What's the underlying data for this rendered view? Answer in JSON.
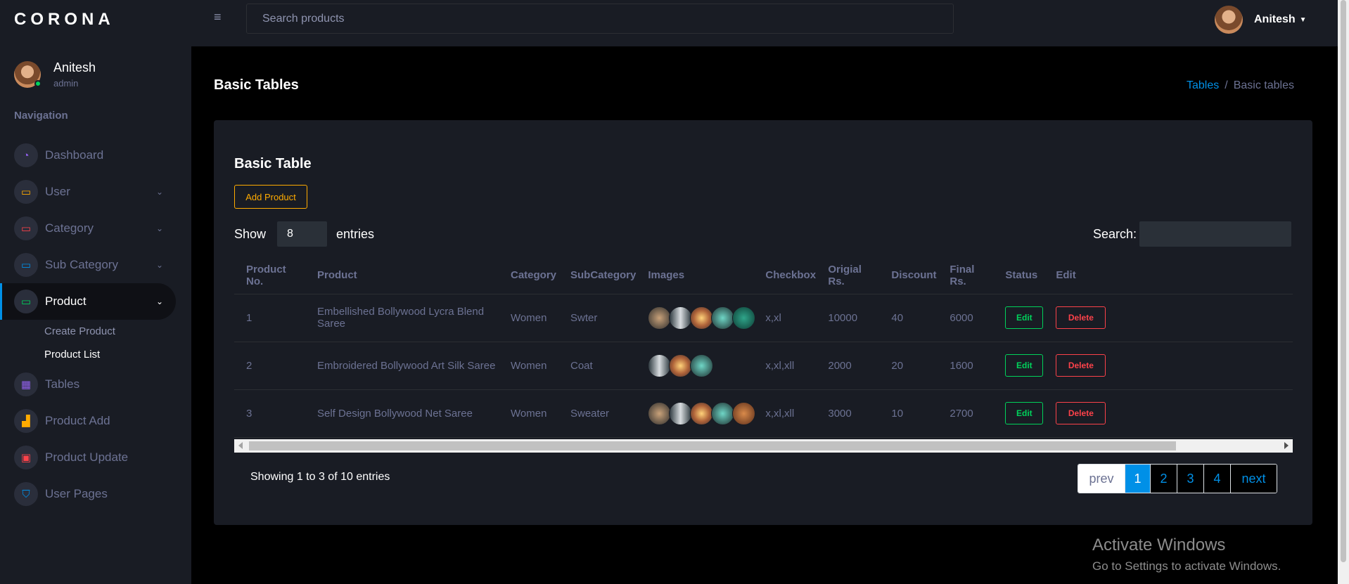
{
  "brand": "CORONA",
  "profile": {
    "name": "Anitesh",
    "role": "admin"
  },
  "nav": {
    "title": "Navigation",
    "items": [
      {
        "label": "Dashboard",
        "icon": "speedometer-icon",
        "color": "#8f5fe8"
      },
      {
        "label": "User",
        "icon": "laptop-icon",
        "color": "#ffab00"
      },
      {
        "label": "Category",
        "icon": "laptop-icon",
        "color": "#fc424a"
      },
      {
        "label": "Sub Category",
        "icon": "laptop-icon",
        "color": "#0090e7"
      },
      {
        "label": "Product",
        "icon": "laptop-icon",
        "color": "#00d25b"
      },
      {
        "label": "Tables",
        "icon": "table-icon",
        "color": "#8f5fe8"
      },
      {
        "label": "Product Add",
        "icon": "chart-bar-icon",
        "color": "#ffab00"
      },
      {
        "label": "Product Update",
        "icon": "contacts-icon",
        "color": "#fc424a"
      },
      {
        "label": "User Pages",
        "icon": "security-icon",
        "color": "#0090e7"
      }
    ],
    "product_sub": [
      "Create Product",
      "Product List"
    ]
  },
  "topbar": {
    "search_placeholder": "Search products",
    "user": "Anitesh"
  },
  "page": {
    "title": "Basic Tables",
    "breadcrumb": [
      "Tables",
      "Basic tables"
    ]
  },
  "card": {
    "title": "Basic Table",
    "add_button": "Add Product",
    "show_label": "Show",
    "entries_value": "8",
    "entries_label": "entries",
    "search_label": "Search:",
    "columns": [
      "Product No.",
      "Product",
      "Category",
      "SubCategory",
      "Images",
      "Checkbox",
      "Origial Rs.",
      "Discount",
      "Final Rs.",
      "Status",
      "Edit"
    ],
    "rows": [
      {
        "no": "1",
        "product": "Embellished Bollywood Lycra Blend Saree",
        "category": "Women",
        "subcategory": "Swter",
        "checkbox": "x,xl",
        "original": "10000",
        "discount": "40",
        "final": "6000",
        "images": 5
      },
      {
        "no": "2",
        "product": "Embroidered Bollywood Art Silk Saree",
        "category": "Women",
        "subcategory": "Coat",
        "checkbox": "x,xl,xll",
        "original": "2000",
        "discount": "20",
        "final": "1600",
        "images": 3
      },
      {
        "no": "3",
        "product": "Self Design Bollywood Net Saree",
        "category": "Women",
        "subcategory": "Sweater",
        "checkbox": "x,xl,xll",
        "original": "3000",
        "discount": "10",
        "final": "2700",
        "images": 5
      }
    ],
    "edit_label": "Edit",
    "delete_label": "Delete",
    "info": "Showing 1 to 3 of 10 entries",
    "pager": {
      "prev": "prev",
      "pages": [
        "1",
        "2",
        "3",
        "4"
      ],
      "next": "next"
    }
  },
  "watermark": {
    "title": "Activate Windows",
    "subtitle": "Go to Settings to activate Windows."
  }
}
